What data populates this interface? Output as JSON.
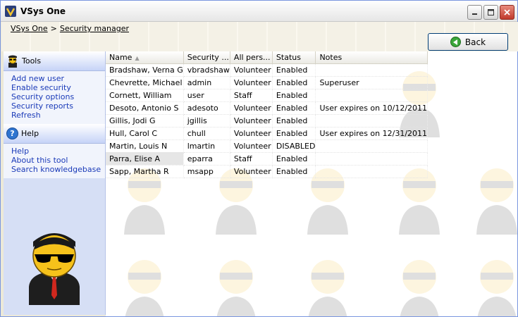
{
  "window": {
    "title": "VSys One"
  },
  "breadcrumb": {
    "root": "VSys One",
    "separator": ">",
    "current": "Security manager"
  },
  "toolbar": {
    "back_label": "Back"
  },
  "tools": {
    "title": "Tools",
    "items": [
      {
        "label": "Add new user"
      },
      {
        "label": "Enable security"
      },
      {
        "label": "Security options"
      },
      {
        "label": "Security reports"
      },
      {
        "label": "Refresh"
      }
    ]
  },
  "help": {
    "title": "Help",
    "items": [
      {
        "label": "Help"
      },
      {
        "label": "About this tool"
      },
      {
        "label": "Search knowledgebase"
      }
    ]
  },
  "grid": {
    "columns": [
      "Name",
      "Security ...",
      "All pers...",
      "Status",
      "Notes"
    ],
    "sort_indicator": "▲",
    "rows": [
      {
        "name": "Bradshaw, Verna G",
        "login": "vbradshaw",
        "role": "Volunteer",
        "status": "Enabled",
        "notes": ""
      },
      {
        "name": "Chevrette, Michael",
        "login": "admin",
        "role": "Volunteer",
        "status": "Enabled",
        "notes": "Superuser"
      },
      {
        "name": "Cornett, William",
        "login": "user",
        "role": "Staff",
        "status": "Enabled",
        "notes": ""
      },
      {
        "name": "Desoto, Antonio S",
        "login": "adesoto",
        "role": "Volunteer",
        "status": "Enabled",
        "notes": "User expires on 10/12/2011"
      },
      {
        "name": "Gillis, Jodi G",
        "login": "jgillis",
        "role": "Volunteer",
        "status": "Enabled",
        "notes": ""
      },
      {
        "name": "Hull, Carol C",
        "login": "chull",
        "role": "Volunteer",
        "status": "Enabled",
        "notes": "User expires on 12/31/2011"
      },
      {
        "name": "Martin, Louis N",
        "login": "lmartin",
        "role": "Volunteer",
        "status": "DISABLED",
        "notes": ""
      },
      {
        "name": "Parra, Elise A",
        "login": "eparra",
        "role": "Staff",
        "status": "Enabled",
        "notes": ""
      },
      {
        "name": "Sapp, Martha R",
        "login": "msapp",
        "role": "Volunteer",
        "status": "Enabled",
        "notes": ""
      }
    ],
    "selected_row": 7
  },
  "colors": {
    "link": "#1a3ab8",
    "panel": "#d6dff5",
    "accent_green": "#3aa63a",
    "close_red": "#c0392b"
  }
}
